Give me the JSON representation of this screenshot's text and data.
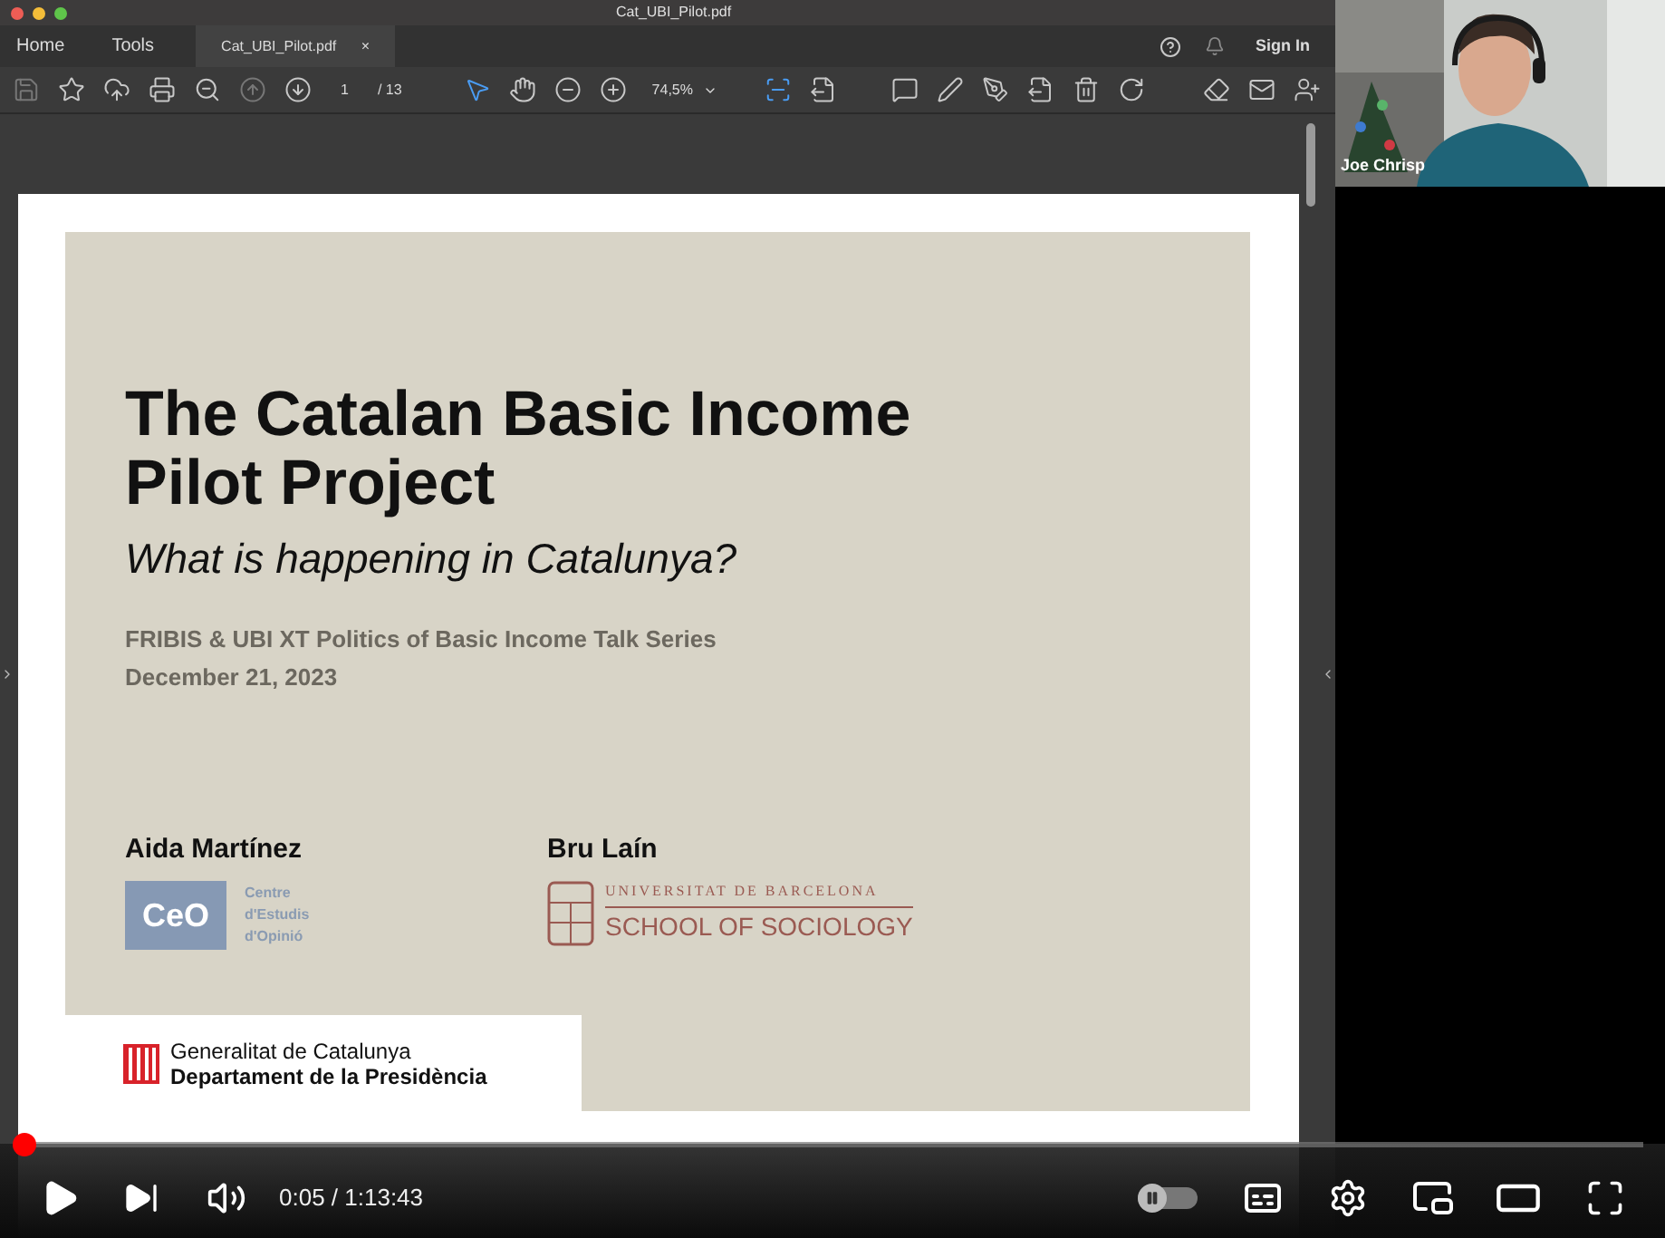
{
  "pdf_window": {
    "title": "Cat_UBI_Pilot.pdf",
    "nav": [
      "Home",
      "Tools"
    ],
    "tab": {
      "label": "Cat_UBI_Pilot.pdf",
      "close": "×"
    },
    "sign_in": "Sign In",
    "toolbar": {
      "page": "1",
      "page_total": "/ 13",
      "zoom": "74,5%"
    }
  },
  "slide": {
    "title": "The Catalan Basic Income Pilot Project",
    "subtitle": "What is happening in Catalunya?",
    "event": "FRIBIS & UBI XT Politics of Basic Income Talk Series",
    "date": "December 21, 2023",
    "authors": [
      {
        "name": "Aida Martínez",
        "logo_text": "CeO",
        "org_lines": [
          "Centre",
          "d'Estudis",
          "d'Opinió"
        ]
      },
      {
        "name": "Bru Laín",
        "org_top": "UNIVERSITAT DE BARCELONA",
        "org_bottom": "SCHOOL OF SOCIOLOGY"
      }
    ],
    "footer": [
      "Generalitat de Catalunya",
      "Departament de la Presidència"
    ]
  },
  "participant": {
    "name": "Joe Chrisp"
  },
  "player": {
    "progress": {
      "level": 0.001
    },
    "time": "0:05 / 1:13:43",
    "autoplay": {
      "on": false
    }
  }
}
